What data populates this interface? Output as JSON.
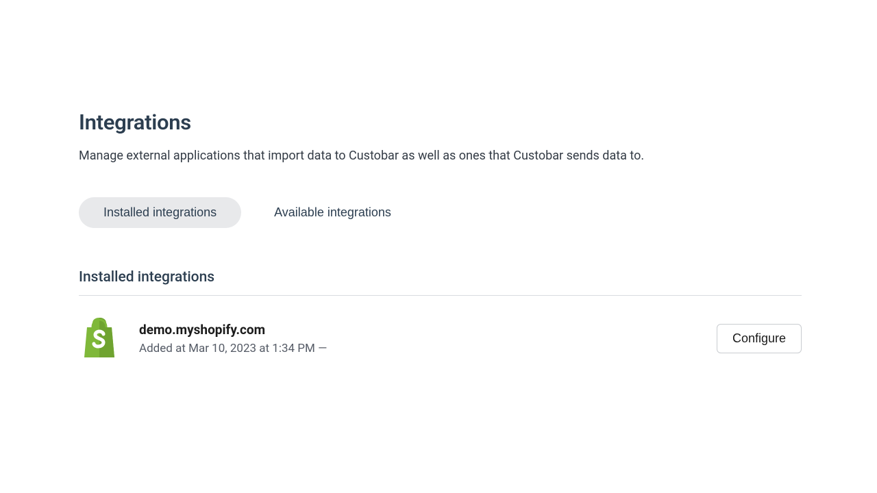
{
  "page": {
    "title": "Integrations",
    "description": "Manage external applications that import data to Custobar as well as ones that Custobar sends data to."
  },
  "tabs": {
    "installed": "Installed integrations",
    "available": "Available integrations"
  },
  "section": {
    "title": "Installed integrations"
  },
  "integration": {
    "name": "demo.myshopify.com",
    "meta": "Added at Mar 10, 2023 at 1:34 PM   —",
    "configure": "Configure"
  }
}
